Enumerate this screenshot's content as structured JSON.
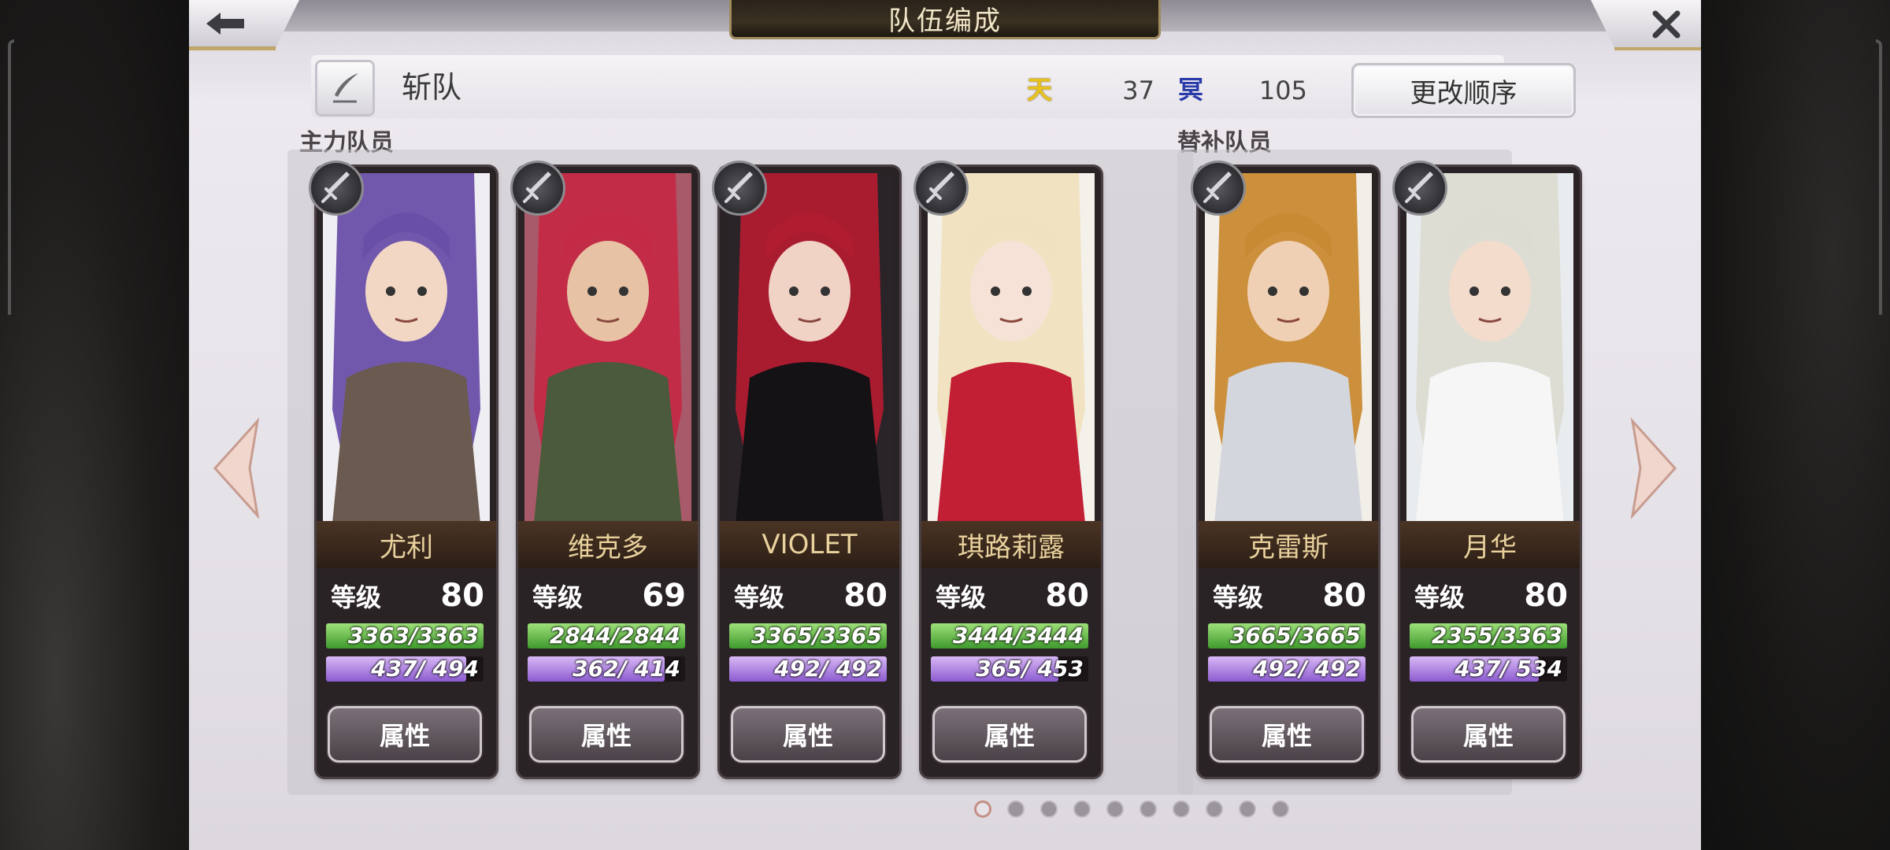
{
  "header": {
    "title": "队伍编成"
  },
  "party": {
    "name": "斩队",
    "stat1_icon_text": "天",
    "stat1_value": "37",
    "stat2_icon_text": "冥",
    "stat2_value": "105",
    "reorder_label": "更改顺序"
  },
  "sections": {
    "main_label": "主力队员",
    "sub_label": "替补队员"
  },
  "level_label": "等级",
  "attr_label": "属性",
  "members": [
    {
      "name": "尤利",
      "level": "80",
      "hp": "3363/3363",
      "mp": " 437/ 494",
      "mp_fill": 0.885
    },
    {
      "name": "维克多",
      "level": "69",
      "hp": "2844/2844",
      "mp": " 362/ 414",
      "mp_fill": 0.874
    },
    {
      "name": "VIOLET",
      "level": "80",
      "hp": "3365/3365",
      "mp": " 492/ 492",
      "mp_fill": 1.0
    },
    {
      "name": "琪路莉露",
      "level": "80",
      "hp": "3444/3444",
      "mp": " 365/ 453",
      "mp_fill": 0.806
    },
    {
      "name": "克雷斯",
      "level": "80",
      "hp": "3665/3665",
      "mp": " 492/ 492",
      "mp_fill": 1.0
    },
    {
      "name": "月华",
      "level": "80",
      "hp": "2355/3363",
      "mp": " 437/ 534",
      "mp_fill": 0.818
    }
  ],
  "pagination": {
    "total": 10,
    "active": 0
  },
  "colors": {
    "name_text": "#e8d19c",
    "hp": "#5bbf3d",
    "mp": "#a87ae0",
    "accent_gold": "#c2a76a"
  }
}
